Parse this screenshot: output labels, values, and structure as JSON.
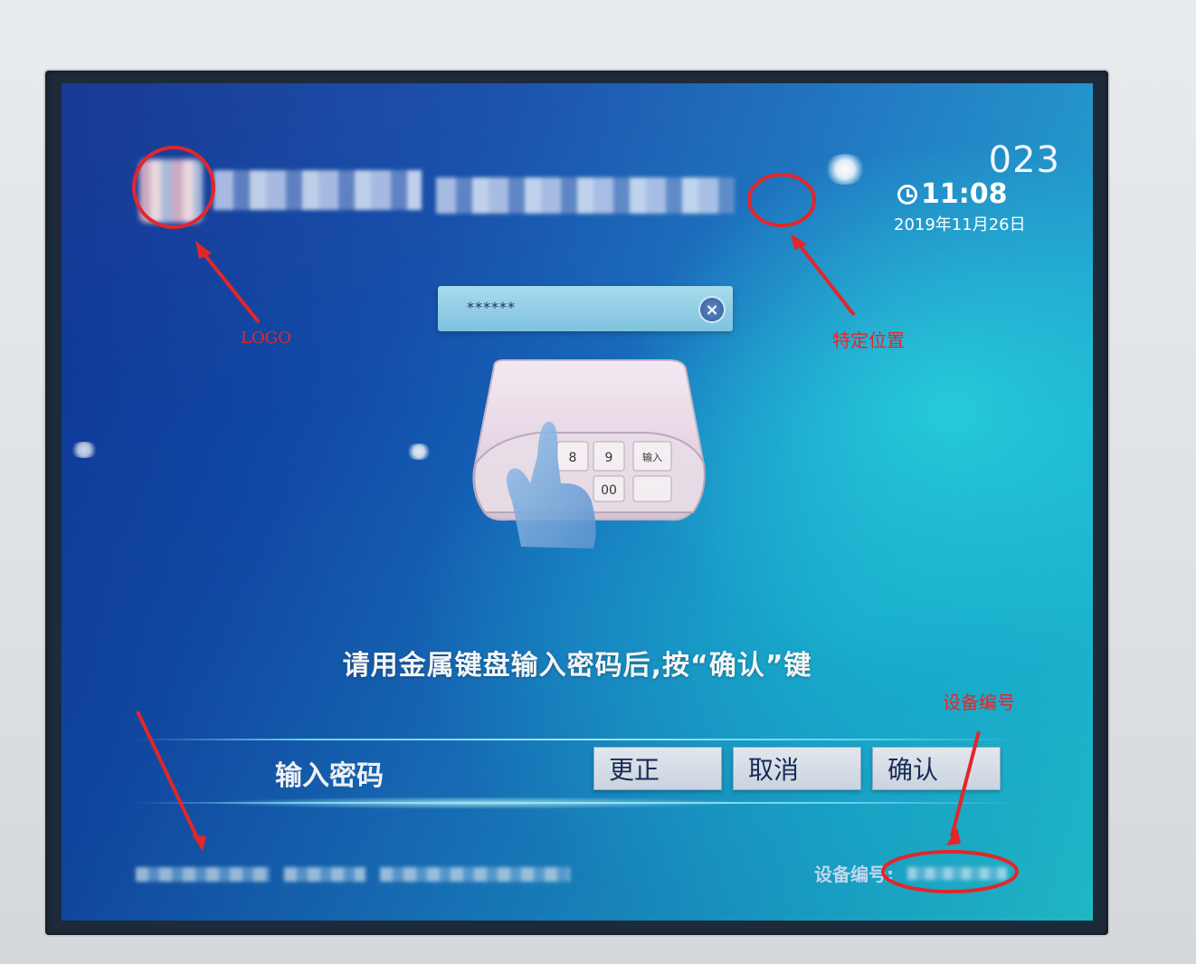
{
  "kiosk": {
    "counter": "023",
    "time": "11:08",
    "date": "2019年11月26日",
    "password_value": "******",
    "instruction": "请用金属键盘输入密码后,按“确认”键",
    "section_title": "输入密码",
    "buttons": [
      "更正",
      "取消",
      "确认"
    ],
    "device_label": "设备编号:",
    "pinpad": {
      "keys": [
        "8",
        "9",
        "输入",
        "00"
      ]
    }
  },
  "annotations": {
    "logo": "LOGO",
    "specific_position": "特定位置",
    "device_number": "设备编号",
    "color": "#e3262a"
  },
  "icons": [
    "clock-icon",
    "clear-icon",
    "hand-icon"
  ]
}
